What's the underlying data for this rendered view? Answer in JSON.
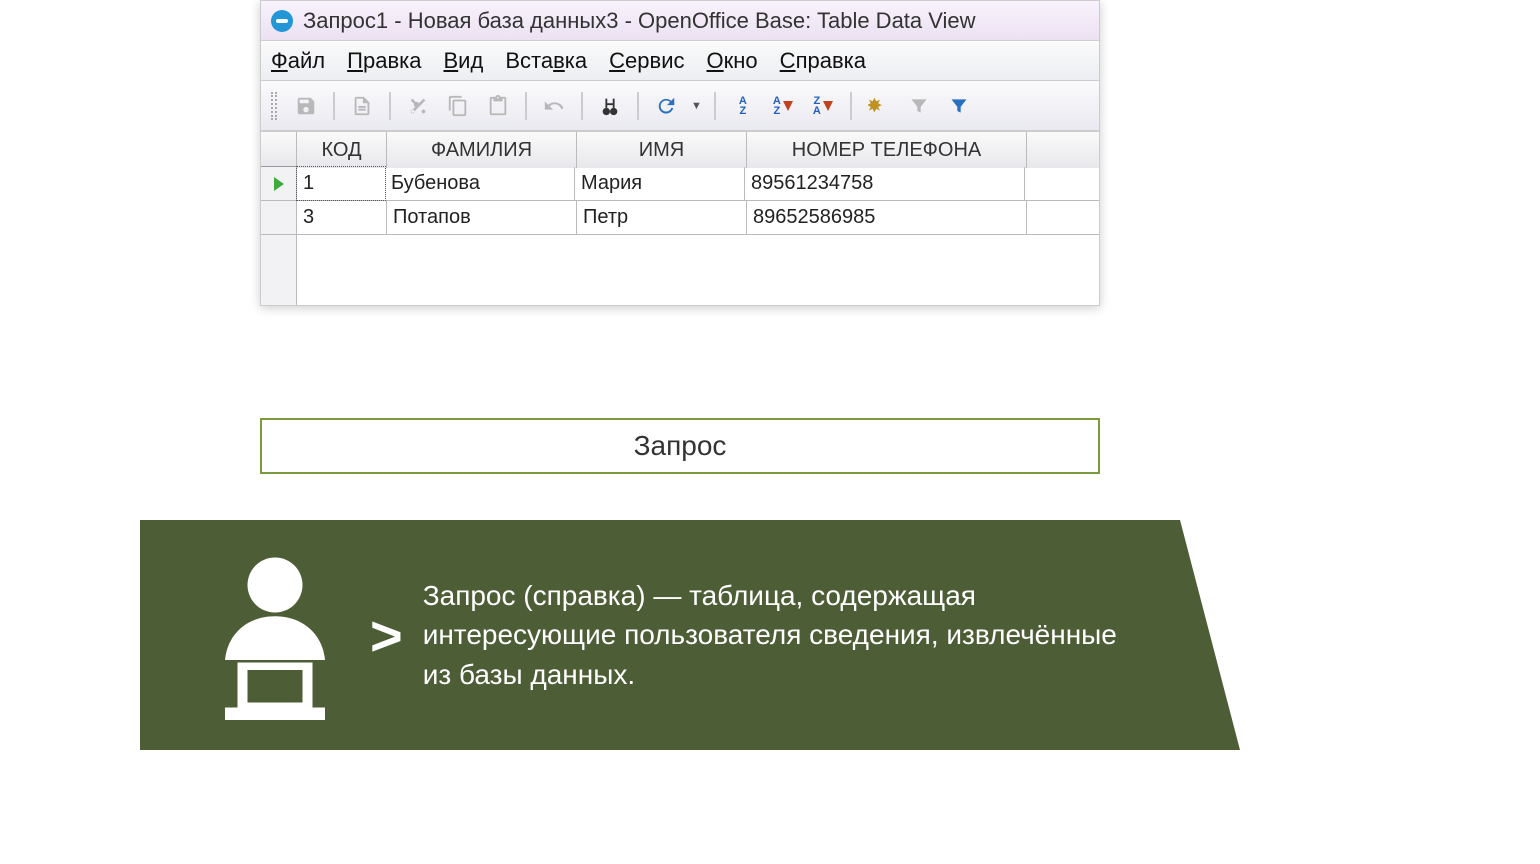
{
  "window": {
    "title": "Запрос1 - Новая база данных3 - OpenOffice Base: Table Data View"
  },
  "menu": {
    "file": "Файл",
    "edit": "Правка",
    "view": "Вид",
    "insert": "Вставка",
    "tools": "Сервис",
    "window": "Окно",
    "help": "Справка"
  },
  "columns": {
    "kod": "КОД",
    "fam": "ФАМИЛИЯ",
    "name": "ИМЯ",
    "phone": "НОМЕР ТЕЛЕФОНА"
  },
  "rows": [
    {
      "kod": "1",
      "fam": "Бубенова",
      "name": "Мария",
      "phone": "89561234758"
    },
    {
      "kod": "3",
      "fam": "Потапов",
      "name": "Петр",
      "phone": "89652586985"
    }
  ],
  "caption": "Запрос",
  "definition": {
    "chevron": ">",
    "text": "Запрос (справка) — таблица, содержащая интересующие пользователя сведения, извлечённые из базы данных."
  },
  "icons": {
    "save": "save-icon",
    "edit": "edit-doc-icon",
    "cut": "cut-icon",
    "copy": "copy-icon",
    "paste": "paste-icon",
    "undo": "undo-icon",
    "find": "binoculars-icon",
    "refresh": "refresh-icon",
    "sort": "sort-icon",
    "sort_asc": "sort-asc-icon",
    "sort_desc": "sort-desc-icon",
    "autofilter_wand": "autofilter-wand-icon",
    "apply_filter": "apply-filter-icon",
    "remove_filter": "remove-filter-icon"
  }
}
